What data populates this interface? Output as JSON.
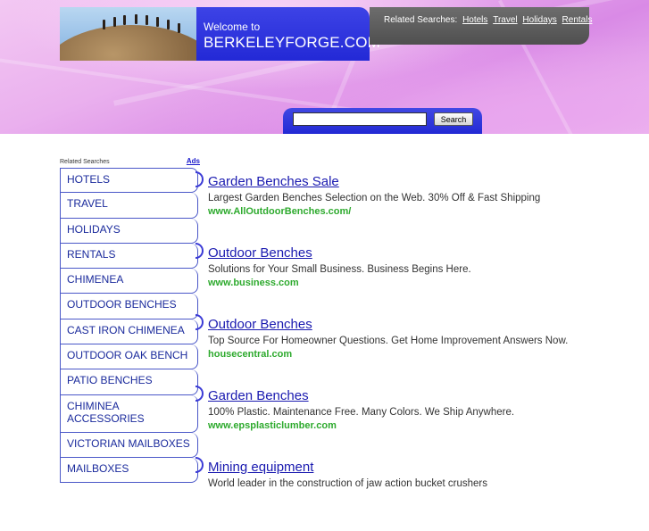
{
  "header": {
    "welcome": "Welcome to",
    "domain": "BERKELEYFORGE.COM",
    "related_label": "Related Searches:",
    "related_links": [
      "Hotels",
      "Travel",
      "Holidays",
      "Rentals"
    ]
  },
  "search": {
    "value": "",
    "button_label": "Search"
  },
  "sidebar": {
    "heading": "Related Searches",
    "ads_label": "Ads",
    "items": [
      {
        "label": "HOTELS"
      },
      {
        "label": "TRAVEL"
      },
      {
        "label": "HOLIDAYS"
      },
      {
        "label": "RENTALS"
      },
      {
        "label": "CHIMENEA"
      },
      {
        "label": "OUTDOOR BENCHES"
      },
      {
        "label": "CAST IRON CHIMENEA"
      },
      {
        "label": "OUTDOOR OAK BENCH"
      },
      {
        "label": "PATIO BENCHES"
      },
      {
        "label": "CHIMINEA ACCESSORIES"
      },
      {
        "label": "VICTORIAN MAILBOXES"
      },
      {
        "label": "MAILBOXES"
      }
    ]
  },
  "results": [
    {
      "title": "Garden Benches Sale",
      "desc": "Largest Garden Benches Selection on the Web. 30% Off & Fast Shipping",
      "url": "www.AllOutdoorBenches.com/"
    },
    {
      "title": "Outdoor Benches",
      "desc": "Solutions for Your Small Business. Business Begins Here.",
      "url": "www.business.com"
    },
    {
      "title": "Outdoor Benches",
      "desc": "Top Source For Homeowner Questions. Get Home Improvement Answers Now.",
      "url": "housecentral.com"
    },
    {
      "title": "Garden Benches",
      "desc": "100% Plastic. Maintenance Free. Many Colors. We Ship Anywhere.",
      "url": "www.epsplasticlumber.com"
    },
    {
      "title": "Mining equipment",
      "desc": "World leader in the construction of jaw action bucket crushers",
      "url": ""
    }
  ],
  "colors": {
    "banner_blue": "#2329d6",
    "banner_gray": "#4f4f4f",
    "link_blue": "#1a1ab0",
    "url_green": "#2eaa2e"
  }
}
